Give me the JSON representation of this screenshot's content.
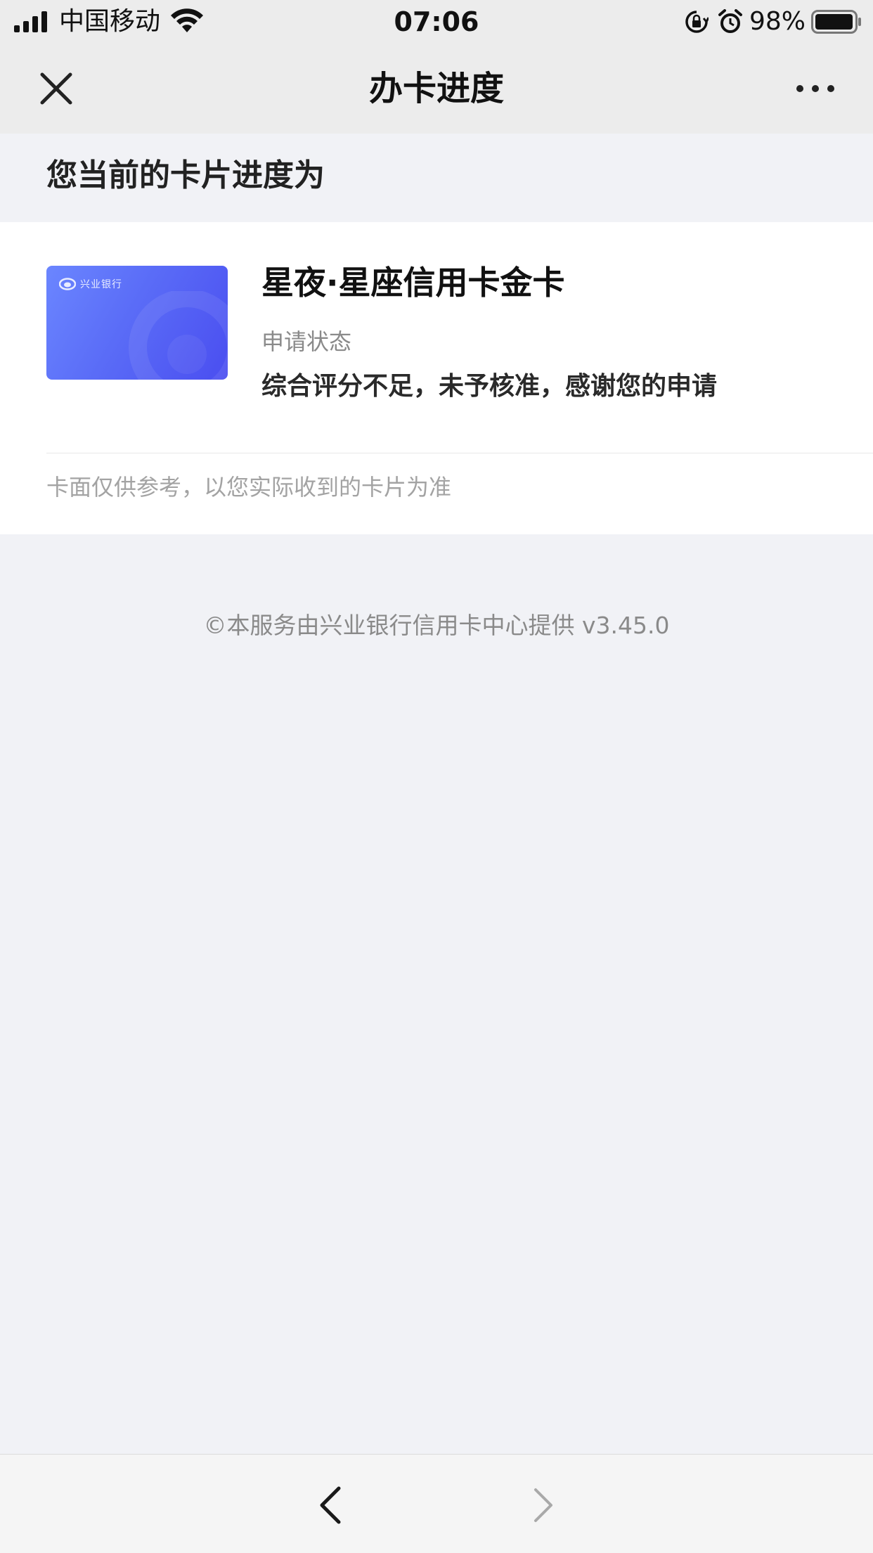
{
  "status_bar": {
    "carrier": "中国移动",
    "time": "07:06",
    "battery_percent": "98%"
  },
  "nav": {
    "title": "办卡进度",
    "close_icon": "close-icon",
    "more_icon": "more-icon"
  },
  "section": {
    "title": "您当前的卡片进度为"
  },
  "card": {
    "bank_logo_text": "兴业银行",
    "name": "星夜·星座信用卡金卡",
    "status_label": "申请状态",
    "status_value": "综合评分不足，未予核准，感谢您的申请",
    "disclaimer": "卡面仅供参考，以您实际收到的卡片为准",
    "gradient_colors": [
      "#6b86ff",
      "#5a6cf7",
      "#4a4ef0"
    ]
  },
  "footer": {
    "note": "©本服务由兴业银行信用卡中心提供 v3.45.0"
  },
  "toolbar": {
    "back_icon": "chevron-left-icon",
    "forward_icon": "chevron-right-icon",
    "forward_enabled": false
  }
}
